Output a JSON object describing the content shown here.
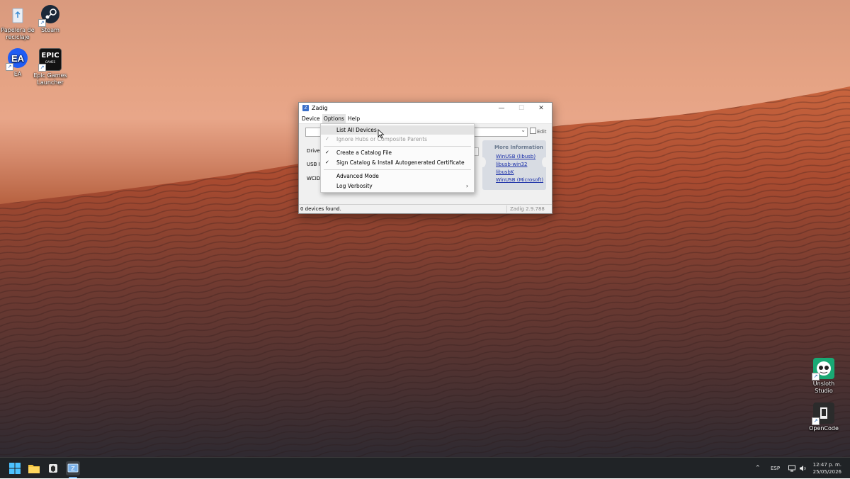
{
  "desktop": {
    "icons": [
      {
        "label": "Papelera de reciclaje",
        "icon": "recycle-bin-icon"
      },
      {
        "label": "Steam",
        "icon": "steam-icon"
      },
      {
        "label": "EA",
        "icon": "ea-icon"
      },
      {
        "label": "Epic Games Launcher",
        "icon": "epic-games-icon",
        "logo_text": "EPIC",
        "logo_sub": "GAMES"
      },
      {
        "label": "Unsloth Studio",
        "icon": "unsloth-icon"
      },
      {
        "label": "OpenCode",
        "icon": "opencode-icon"
      }
    ]
  },
  "window": {
    "title": "Zadig",
    "menubar": [
      "Device",
      "Options",
      "Help"
    ],
    "edit_label": "Edit",
    "labels": {
      "driver": "Driver",
      "usb_id": "USB ID",
      "wcid": "WCID"
    },
    "more_info": {
      "header": "More Information",
      "links": [
        "WinUSB (libusb)",
        "libusb-win32",
        "libusbK",
        "WinUSB (Microsoft)"
      ]
    },
    "status_left": "0 devices found.",
    "status_right": "Zadig 2.9.788"
  },
  "options_menu": {
    "items": [
      {
        "label": "List All Devices",
        "checked": false,
        "disabled": false,
        "highlighted": true
      },
      {
        "label": "Ignore Hubs or Composite Parents",
        "checked": true,
        "disabled": true
      },
      {
        "label": "Create a Catalog File",
        "checked": true,
        "disabled": false
      },
      {
        "label": "Sign Catalog & Install Autogenerated Certificate",
        "checked": true,
        "disabled": false
      },
      {
        "label": "Advanced Mode",
        "checked": false,
        "disabled": false
      },
      {
        "label": "Log Verbosity",
        "checked": false,
        "disabled": false,
        "submenu": true
      }
    ],
    "check_glyph": "✓",
    "submenu_glyph": "›"
  },
  "taskbar": {
    "apps": [
      "start-icon",
      "file-explorer-icon",
      "app-icon",
      "zadig-icon"
    ],
    "language": "ESP",
    "time": "12:47 p. m.",
    "date": "25/05/2026"
  },
  "colors": {
    "accent": "#3a6fc9",
    "link": "#1a2fa8",
    "taskbar": "#202326"
  }
}
